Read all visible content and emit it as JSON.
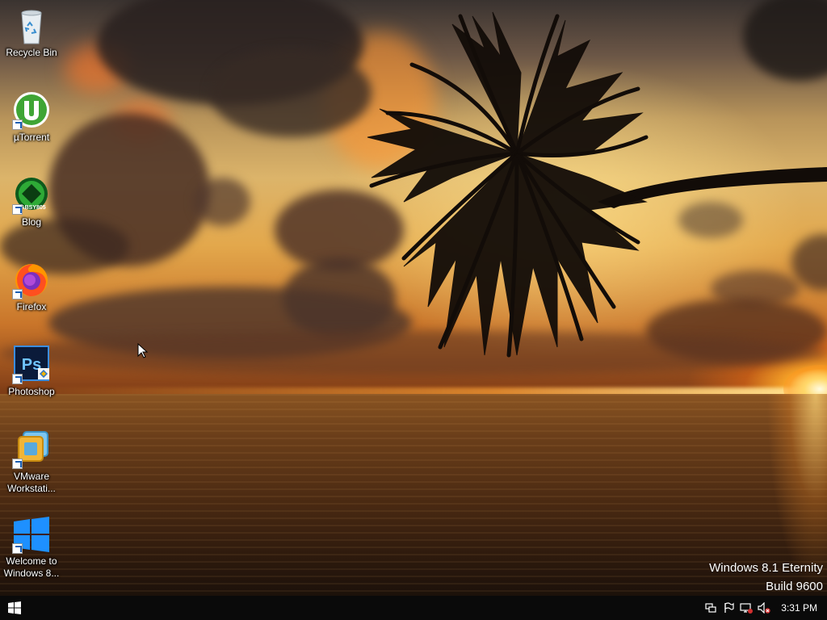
{
  "desktop": {
    "icons": [
      {
        "label": "Recycle Bin"
      },
      {
        "label": "µTorrent"
      },
      {
        "label": "Blog",
        "badge_text": "LABSY805"
      },
      {
        "label": "Firefox"
      },
      {
        "label": "Photoshop",
        "badge_text": "Ps"
      },
      {
        "label": "VMware\nWorkstati..."
      },
      {
        "label": "Welcome to\nWindows 8..."
      }
    ]
  },
  "watermark": {
    "line1": "Windows 8.1 Eternity",
    "line2": "Build 9600"
  },
  "taskbar": {
    "start_icon": "windows-logo-icon",
    "tray_icons": [
      "action-center-icon",
      "flag-icon",
      "network-icon",
      "volume-muted-icon"
    ],
    "clock": "3:31 PM"
  },
  "colors": {
    "taskbar": "#0a0a0a",
    "sky_top": "#3a3330",
    "sky_glow": "#e3a84c",
    "sea": "#4e2c13",
    "sun": "#fffbe0"
  }
}
